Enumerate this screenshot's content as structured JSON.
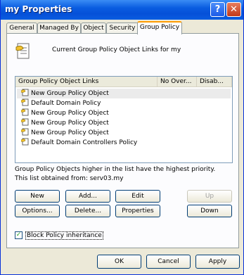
{
  "window": {
    "title": "my Properties",
    "help_glyph": "?",
    "close_glyph": "✕"
  },
  "tabs": [
    {
      "label": "General"
    },
    {
      "label": "Managed By"
    },
    {
      "label": "Object"
    },
    {
      "label": "Security"
    },
    {
      "label": "Group Policy"
    }
  ],
  "active_tab": "Group Policy",
  "panel": {
    "current_label": "Current Group Policy Object Links for my"
  },
  "list": {
    "columns": [
      "Group Policy Object Links",
      "No Over...",
      "Disab..."
    ],
    "rows": [
      {
        "name": "New Group Policy Object"
      },
      {
        "name": "Default Domain Policy"
      },
      {
        "name": "New Group Policy Object"
      },
      {
        "name": "New Group Policy Object"
      },
      {
        "name": "New Group Policy Object"
      },
      {
        "name": "Default Domain Controllers Policy"
      }
    ]
  },
  "info": {
    "line1": "Group Policy Objects higher in the list have the highest priority.",
    "line2": "This list obtained from: serv03.my"
  },
  "buttons": {
    "new": "New",
    "add": "Add...",
    "edit": "Edit",
    "up": "Up",
    "options": "Options...",
    "delete": "Delete...",
    "properties": "Properties",
    "down": "Down"
  },
  "block_inheritance": {
    "label": "Block Policy inheritance",
    "checked": true,
    "check_glyph": "✓"
  },
  "footer": {
    "ok": "OK",
    "cancel": "Cancel",
    "apply": "Apply"
  }
}
